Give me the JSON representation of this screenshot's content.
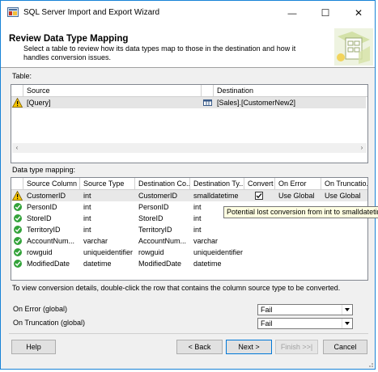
{
  "window": {
    "title": "SQL Server Import and Export Wizard",
    "minimize": "—",
    "maximize": "☐",
    "close": "✕"
  },
  "header": {
    "title": "Review Data Type Mapping",
    "subtitle": "Select a table to review how its data types map to those in the destination and how it handles conversion issues."
  },
  "table_section": {
    "label": "Table:",
    "columns": [
      "Source",
      "Destination"
    ],
    "rows": [
      {
        "source": "[Query]",
        "destination": "[Sales].[CustomerNew2]"
      }
    ]
  },
  "mapping_section": {
    "label": "Data type mapping:",
    "columns": [
      "Source Column",
      "Source Type",
      "Destination Co...",
      "Destination Ty...",
      "Convert",
      "On Error",
      "On Truncatio..."
    ],
    "rows": [
      {
        "status": "warning",
        "source_column": "CustomerID",
        "source_type": "int",
        "dest_column": "CustomerID",
        "dest_type": "smalldatetime",
        "convert": true,
        "on_error": "Use Global",
        "on_truncation": "Use Global"
      },
      {
        "status": "ok",
        "source_column": "PersonID",
        "source_type": "int",
        "dest_column": "PersonID",
        "dest_type": "int",
        "convert": false,
        "on_error": "",
        "on_truncation": ""
      },
      {
        "status": "ok",
        "source_column": "StoreID",
        "source_type": "int",
        "dest_column": "StoreID",
        "dest_type": "int",
        "convert": false,
        "on_error": "",
        "on_truncation": ""
      },
      {
        "status": "ok",
        "source_column": "TerritoryID",
        "source_type": "int",
        "dest_column": "TerritoryID",
        "dest_type": "int",
        "convert": false,
        "on_error": "",
        "on_truncation": ""
      },
      {
        "status": "ok",
        "source_column": "AccountNum...",
        "source_type": "varchar",
        "dest_column": "AccountNum...",
        "dest_type": "varchar",
        "convert": false,
        "on_error": "",
        "on_truncation": ""
      },
      {
        "status": "ok",
        "source_column": "rowguid",
        "source_type": "uniqueidentifier",
        "dest_column": "rowguid",
        "dest_type": "uniqueidentifier",
        "convert": false,
        "on_error": "",
        "on_truncation": ""
      },
      {
        "status": "ok",
        "source_column": "ModifiedDate",
        "source_type": "datetime",
        "dest_column": "ModifiedDate",
        "dest_type": "datetime",
        "convert": false,
        "on_error": "",
        "on_truncation": ""
      }
    ],
    "tooltip": "Potential lost conversion from int to smalldatetime"
  },
  "hint": "To view conversion details, double-click the row that contains the column source type to be converted.",
  "global": {
    "on_error_label": "On Error (global)",
    "on_error_value": "Fail",
    "on_truncation_label": "On Truncation (global)",
    "on_truncation_value": "Fail"
  },
  "buttons": {
    "help": "Help",
    "back": "< Back",
    "next": "Next >",
    "finish": "Finish >>|",
    "cancel": "Cancel"
  },
  "colors": {
    "window_border": "#1883d7",
    "ok_icon": "#33a33a",
    "warning_icon": "#f5c400",
    "tooltip_bg": "#ffffe1"
  }
}
